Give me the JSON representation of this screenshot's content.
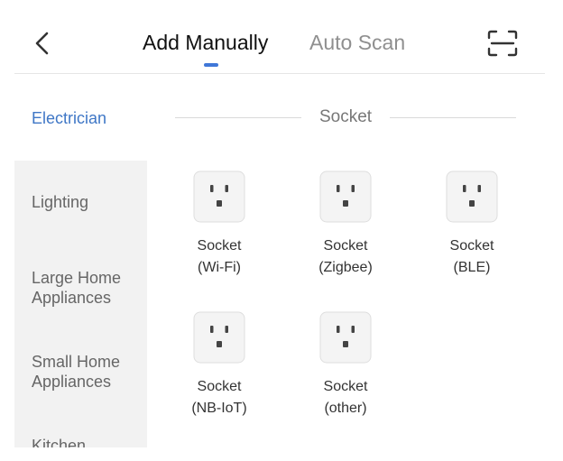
{
  "header": {
    "back_icon": "chevron-left-icon",
    "tabs": [
      {
        "label": "Add Manually",
        "active": true
      },
      {
        "label": "Auto Scan",
        "active": false
      }
    ],
    "scan_icon": "scan-frame-icon"
  },
  "sidebar": {
    "items": [
      {
        "label": "Electrician",
        "active": true
      },
      {
        "label": "Lighting",
        "active": false
      },
      {
        "label": "Large Home Appliances",
        "active": false
      },
      {
        "label": "Small Home Appliances",
        "active": false
      },
      {
        "label": "Kitchen",
        "active": false
      }
    ]
  },
  "section": {
    "title": "Socket"
  },
  "devices": [
    {
      "line1": "Socket",
      "line2": "(Wi-Fi)",
      "icon": "socket-icon"
    },
    {
      "line1": "Socket",
      "line2": "(Zigbee)",
      "icon": "socket-icon"
    },
    {
      "line1": "Socket",
      "line2": "(BLE)",
      "icon": "socket-icon"
    },
    {
      "line1": "Socket",
      "line2": "(NB-IoT)",
      "icon": "socket-icon"
    },
    {
      "line1": "Socket",
      "line2": "(other)",
      "icon": "socket-icon"
    }
  ],
  "colors": {
    "accent": "#3f77d8",
    "sidebar_active_text": "#3f77c6",
    "sidebar_bg": "#f2f2f2"
  }
}
